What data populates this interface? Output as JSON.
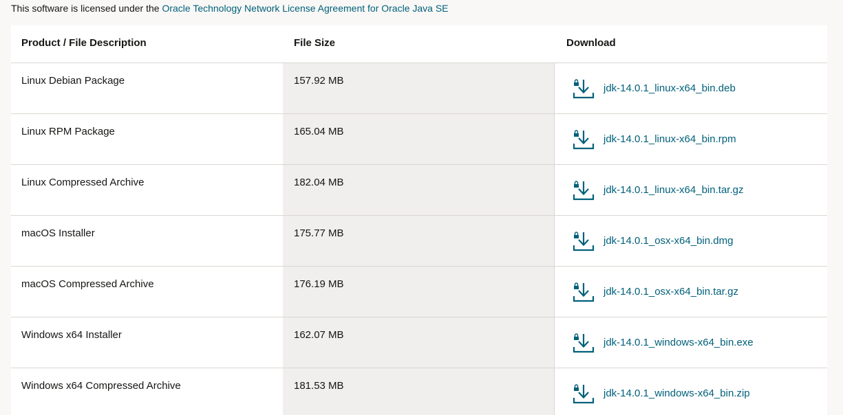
{
  "license": {
    "prefix": "This software is licensed under the ",
    "link": "Oracle Technology Network License Agreement for Oracle Java SE"
  },
  "table": {
    "headers": {
      "description": "Product / File Description",
      "size": "File Size",
      "download": "Download"
    },
    "rows": [
      {
        "description": "Linux Debian Package",
        "size": "157.92 MB",
        "file": "jdk-14.0.1_linux-x64_bin.deb"
      },
      {
        "description": "Linux RPM Package",
        "size": "165.04 MB",
        "file": "jdk-14.0.1_linux-x64_bin.rpm"
      },
      {
        "description": "Linux Compressed Archive",
        "size": "182.04 MB",
        "file": "jdk-14.0.1_linux-x64_bin.tar.gz"
      },
      {
        "description": "macOS Installer",
        "size": "175.77 MB",
        "file": "jdk-14.0.1_osx-x64_bin.dmg"
      },
      {
        "description": "macOS Compressed Archive",
        "size": "176.19 MB",
        "file": "jdk-14.0.1_osx-x64_bin.tar.gz"
      },
      {
        "description": "Windows x64 Installer",
        "size": "162.07 MB",
        "file": "jdk-14.0.1_windows-x64_bin.exe"
      },
      {
        "description": "Windows x64 Compressed Archive",
        "size": "181.53 MB",
        "file": "jdk-14.0.1_windows-x64_bin.zip"
      }
    ]
  },
  "colors": {
    "link": "#00607a",
    "text": "#161513",
    "size_column_bg": "#f0efed",
    "page_bg": "#f9f8f6"
  },
  "icons": {
    "download": "lock-download-icon"
  }
}
